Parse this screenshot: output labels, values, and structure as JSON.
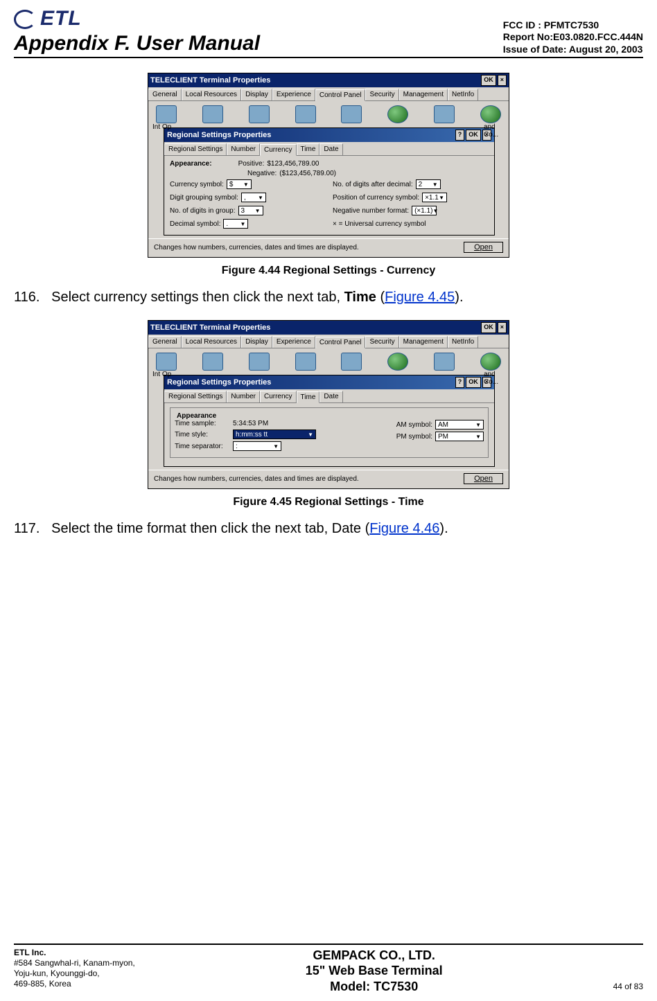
{
  "header": {
    "logo_text": "ETL",
    "appendix": "Appendix F. User Manual",
    "fcc": "FCC ID : PFMTC7530",
    "report": "Report No:E03.0820.FCC.444N",
    "issue": "Issue of Date: August 20, 2003"
  },
  "fig1": {
    "win_title": "TELECLIENT Terminal Properties",
    "ok": "OK",
    "close": "×",
    "tabs": [
      "General",
      "Local Resources",
      "Display",
      "Experience",
      "Control Panel",
      "Security",
      "Management",
      "NetInfo"
    ],
    "left_txt": "Int\nOp",
    "right_txt": "and\nCo...",
    "inner_title": "Regional Settings Properties",
    "help": "?",
    "inner_tabs": [
      "Regional Settings",
      "Number",
      "Currency",
      "Time",
      "Date"
    ],
    "appearance": "Appearance:",
    "positive_lbl": "Positive:",
    "negative_lbl": "Negative:",
    "positive_val": "$123,456,789.00",
    "negative_val": "($123,456,789.00)",
    "currency_symbol_lbl": "Currency symbol:",
    "currency_symbol_val": "$",
    "digits_after_lbl": "No. of digits after decimal:",
    "digits_after_val": "2",
    "digit_group_lbl": "Digit grouping symbol:",
    "digit_group_val": ",",
    "pos_cur_lbl": "Position of currency symbol:",
    "pos_cur_val": "×1.1",
    "digits_group_lbl": "No. of digits in group:",
    "digits_group_val": "3",
    "neg_fmt_lbl": "Negative number format:",
    "neg_fmt_val": "(×1.1)",
    "decimal_lbl": "Decimal symbol:",
    "decimal_val": ".",
    "universal": "× = Universal currency symbol",
    "status": "Changes how numbers, currencies, dates and times are displayed.",
    "open": "Open",
    "caption": "Figure 4.44      Regional Settings - Currency"
  },
  "step116": {
    "num": "116.",
    "a": "Select currency settings then click the next tab, ",
    "bold": "Time",
    "b": " (",
    "link": "Figure 4.45",
    "c": ")."
  },
  "fig2": {
    "win_title": "TELECLIENT Terminal Properties",
    "inner_title": "Regional Settings Properties",
    "inner_tabs": [
      "Regional Settings",
      "Number",
      "Currency",
      "Time",
      "Date"
    ],
    "appearance": "Appearance",
    "time_sample_lbl": "Time sample:",
    "time_sample_val": "5:34:53 PM",
    "time_style_lbl": "Time style:",
    "time_style_val": "h:mm:ss tt",
    "time_sep_lbl": "Time separator:",
    "time_sep_val": ":",
    "am_lbl": "AM symbol:",
    "am_val": "AM",
    "pm_lbl": "PM symbol:",
    "pm_val": "PM",
    "status": "Changes how numbers, currencies, dates and times are displayed.",
    "open": "Open",
    "caption": "Figure 4.45      Regional Settings - Time"
  },
  "step117": {
    "num": "117.",
    "a": "Select the time format then click the next tab, Date (",
    "link": "Figure 4.46",
    "b": ")."
  },
  "footer": {
    "company": "ETL Inc.",
    "addr1": "#584 Sangwhal-ri, Kanam-myon,",
    "addr2": "Yoju-kun, Kyounggi-do,",
    "addr3": "469-885, Korea",
    "center1": "GEMPACK CO., LTD.",
    "center2": "15\" Web Base Terminal",
    "center3": "Model: TC7530",
    "page": "44 of 83"
  }
}
